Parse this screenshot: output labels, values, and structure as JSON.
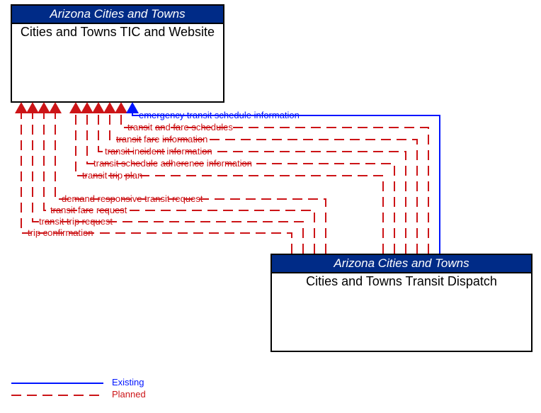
{
  "box_top": {
    "header": "Arizona Cities and Towns",
    "body": "Cities and Towns TIC and Website"
  },
  "box_bottom": {
    "header": "Arizona Cities and Towns",
    "body": "Cities and Towns Transit Dispatch"
  },
  "flows": {
    "f1": "emergency transit schedule information",
    "f2": "transit and fare schedules",
    "f3": "transit fare information",
    "f4": "transit incident information",
    "f5": "transit schedule adherence information",
    "f6": "transit trip plan",
    "f7": "demand responsive transit request",
    "f8": "transit fare request",
    "f9": "transit trip request",
    "f10": "trip confirmation"
  },
  "legend": {
    "existing": "Existing",
    "planned": "Planned"
  }
}
